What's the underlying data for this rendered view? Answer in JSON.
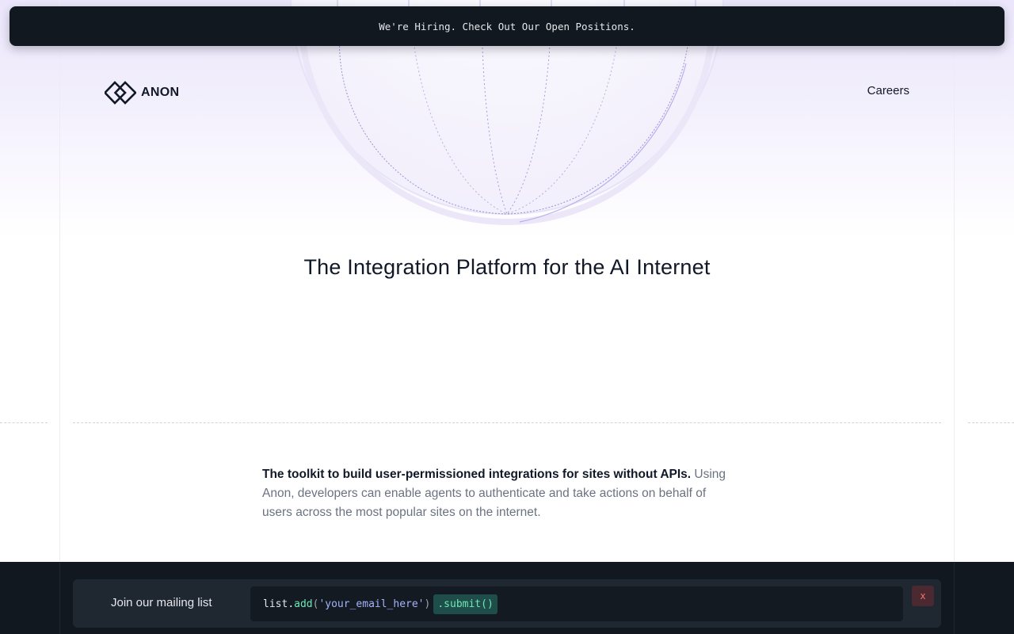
{
  "banner": {
    "text": "We're Hiring. Check Out Our Open Positions."
  },
  "header": {
    "logo_text": "ANON",
    "nav": {
      "careers": "Careers"
    }
  },
  "hero": {
    "title": "The Integration Platform for the AI Internet"
  },
  "about": {
    "lead": "The toolkit to build user-permissioned integrations for sites without APIs.",
    "body": "Using Anon, developers can enable agents to authenticate and take actions on behalf of users across the most popular sites on the internet."
  },
  "mailing": {
    "label": "Join our mailing list",
    "code": {
      "object": "list",
      "dot": ".",
      "method": "add",
      "paren_open": "(",
      "placeholder": "'your_email_here'",
      "paren_close": ")"
    },
    "submit_label": ".submit()",
    "close_label": "x"
  },
  "colors": {
    "banner_bg": "#111820",
    "accent_purple": "#a5b4fc",
    "accent_green": "#6ee7b7",
    "close_red": "#f87171"
  },
  "icons": {
    "logo": "anon-logo-icon",
    "globe": "globe-illustration-icon"
  }
}
